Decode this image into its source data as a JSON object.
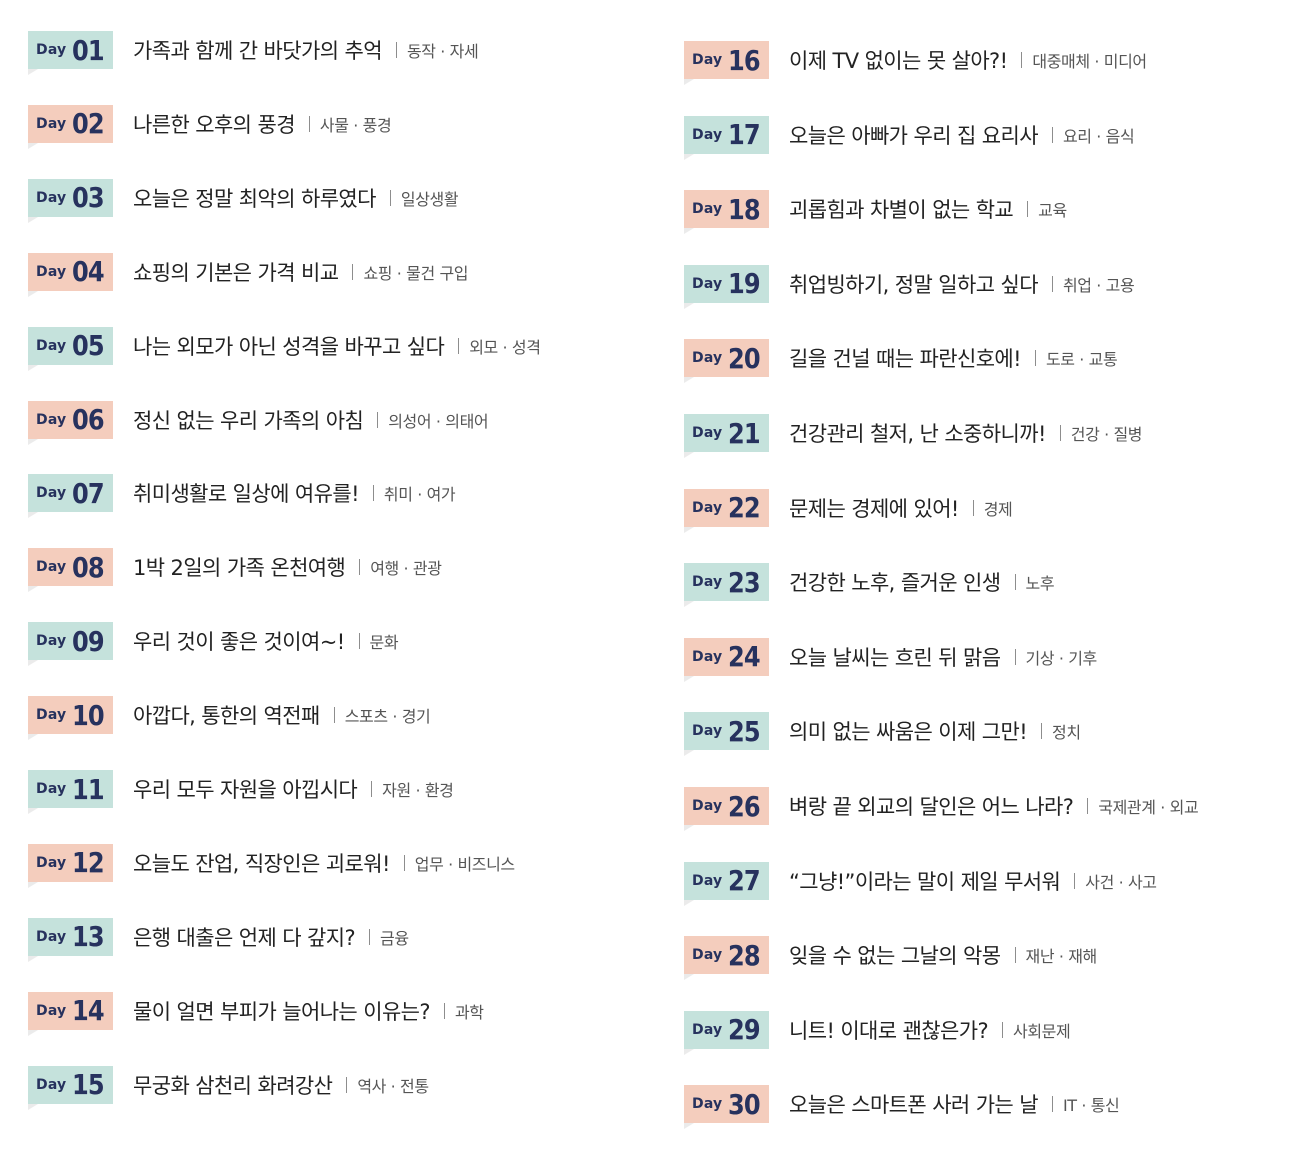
{
  "day_label": "Day",
  "colors": {
    "teal": "#c5e2dc",
    "pink": "#f4cdbd",
    "navy": "#27325e"
  },
  "left_column": [
    {
      "num": "01",
      "title": "가족과 함께 간 바닷가의 추억",
      "category": "동작 · 자세",
      "color": "teal"
    },
    {
      "num": "02",
      "title": "나른한 오후의 풍경",
      "category": "사물 · 풍경",
      "color": "pink"
    },
    {
      "num": "03",
      "title": "오늘은 정말 최악의 하루였다",
      "category": "일상생활",
      "color": "teal"
    },
    {
      "num": "04",
      "title": "쇼핑의 기본은 가격 비교",
      "category": "쇼핑 · 물건 구입",
      "color": "pink"
    },
    {
      "num": "05",
      "title": "나는 외모가 아닌 성격을 바꾸고 싶다",
      "category": "외모 · 성격",
      "color": "teal"
    },
    {
      "num": "06",
      "title": "정신 없는 우리 가족의 아침",
      "category": "의성어 · 의태어",
      "color": "pink"
    },
    {
      "num": "07",
      "title": "취미생활로 일상에 여유를!",
      "category": "취미 · 여가",
      "color": "teal"
    },
    {
      "num": "08",
      "title": "1박 2일의 가족 온천여행",
      "category": "여행 · 관광",
      "color": "pink"
    },
    {
      "num": "09",
      "title": "우리 것이 좋은 것이여~!",
      "category": "문화",
      "color": "teal"
    },
    {
      "num": "10",
      "title": "아깝다, 통한의 역전패",
      "category": "스포츠 · 경기",
      "color": "pink"
    },
    {
      "num": "11",
      "title": "우리 모두 자원을 아낍시다",
      "category": "자원 · 환경",
      "color": "teal"
    },
    {
      "num": "12",
      "title": "오늘도 잔업, 직장인은 괴로워!",
      "category": "업무 · 비즈니스",
      "color": "pink"
    },
    {
      "num": "13",
      "title": "은행 대출은 언제 다 갚지?",
      "category": "금융",
      "color": "teal"
    },
    {
      "num": "14",
      "title": "물이 얼면 부피가 늘어나는 이유는?",
      "category": "과학",
      "color": "pink"
    },
    {
      "num": "15",
      "title": "무궁화 삼천리 화려강산",
      "category": "역사 · 전통",
      "color": "teal"
    }
  ],
  "right_column": [
    {
      "num": "16",
      "title": "이제 TV 없이는 못 살아?!",
      "category": "대중매체 · 미디어",
      "color": "pink"
    },
    {
      "num": "17",
      "title": "오늘은 아빠가 우리 집 요리사",
      "category": "요리 · 음식",
      "color": "teal"
    },
    {
      "num": "18",
      "title": "괴롭힘과 차별이 없는 학교",
      "category": "교육",
      "color": "pink"
    },
    {
      "num": "19",
      "title": "취업빙하기, 정말 일하고 싶다",
      "category": "취업 · 고용",
      "color": "teal"
    },
    {
      "num": "20",
      "title": "길을 건널 때는 파란신호에!",
      "category": "도로 · 교통",
      "color": "pink"
    },
    {
      "num": "21",
      "title": "건강관리 철저, 난 소중하니까!",
      "category": "건강 · 질병",
      "color": "teal"
    },
    {
      "num": "22",
      "title": "문제는 경제에 있어!",
      "category": "경제",
      "color": "pink"
    },
    {
      "num": "23",
      "title": "건강한 노후, 즐거운 인생",
      "category": "노후",
      "color": "teal"
    },
    {
      "num": "24",
      "title": "오늘 날씨는 흐린 뒤 맑음",
      "category": "기상 · 기후",
      "color": "pink"
    },
    {
      "num": "25",
      "title": "의미 없는 싸움은 이제 그만!",
      "category": "정치",
      "color": "teal"
    },
    {
      "num": "26",
      "title": "벼랑 끝 외교의 달인은 어느 나라?",
      "category": "국제관계 · 외교",
      "color": "pink"
    },
    {
      "num": "27",
      "title": "“그냥!”이라는 말이 제일 무서워",
      "category": "사건 · 사고",
      "color": "teal"
    },
    {
      "num": "28",
      "title": "잊을 수 없는 그날의 악몽",
      "category": "재난 · 재해",
      "color": "pink"
    },
    {
      "num": "29",
      "title": "니트! 이대로 괜찮은가?",
      "category": "사회문제",
      "color": "teal"
    },
    {
      "num": "30",
      "title": "오늘은 스마트폰 사러 가는 날",
      "category": "IT · 통신",
      "color": "pink"
    }
  ]
}
